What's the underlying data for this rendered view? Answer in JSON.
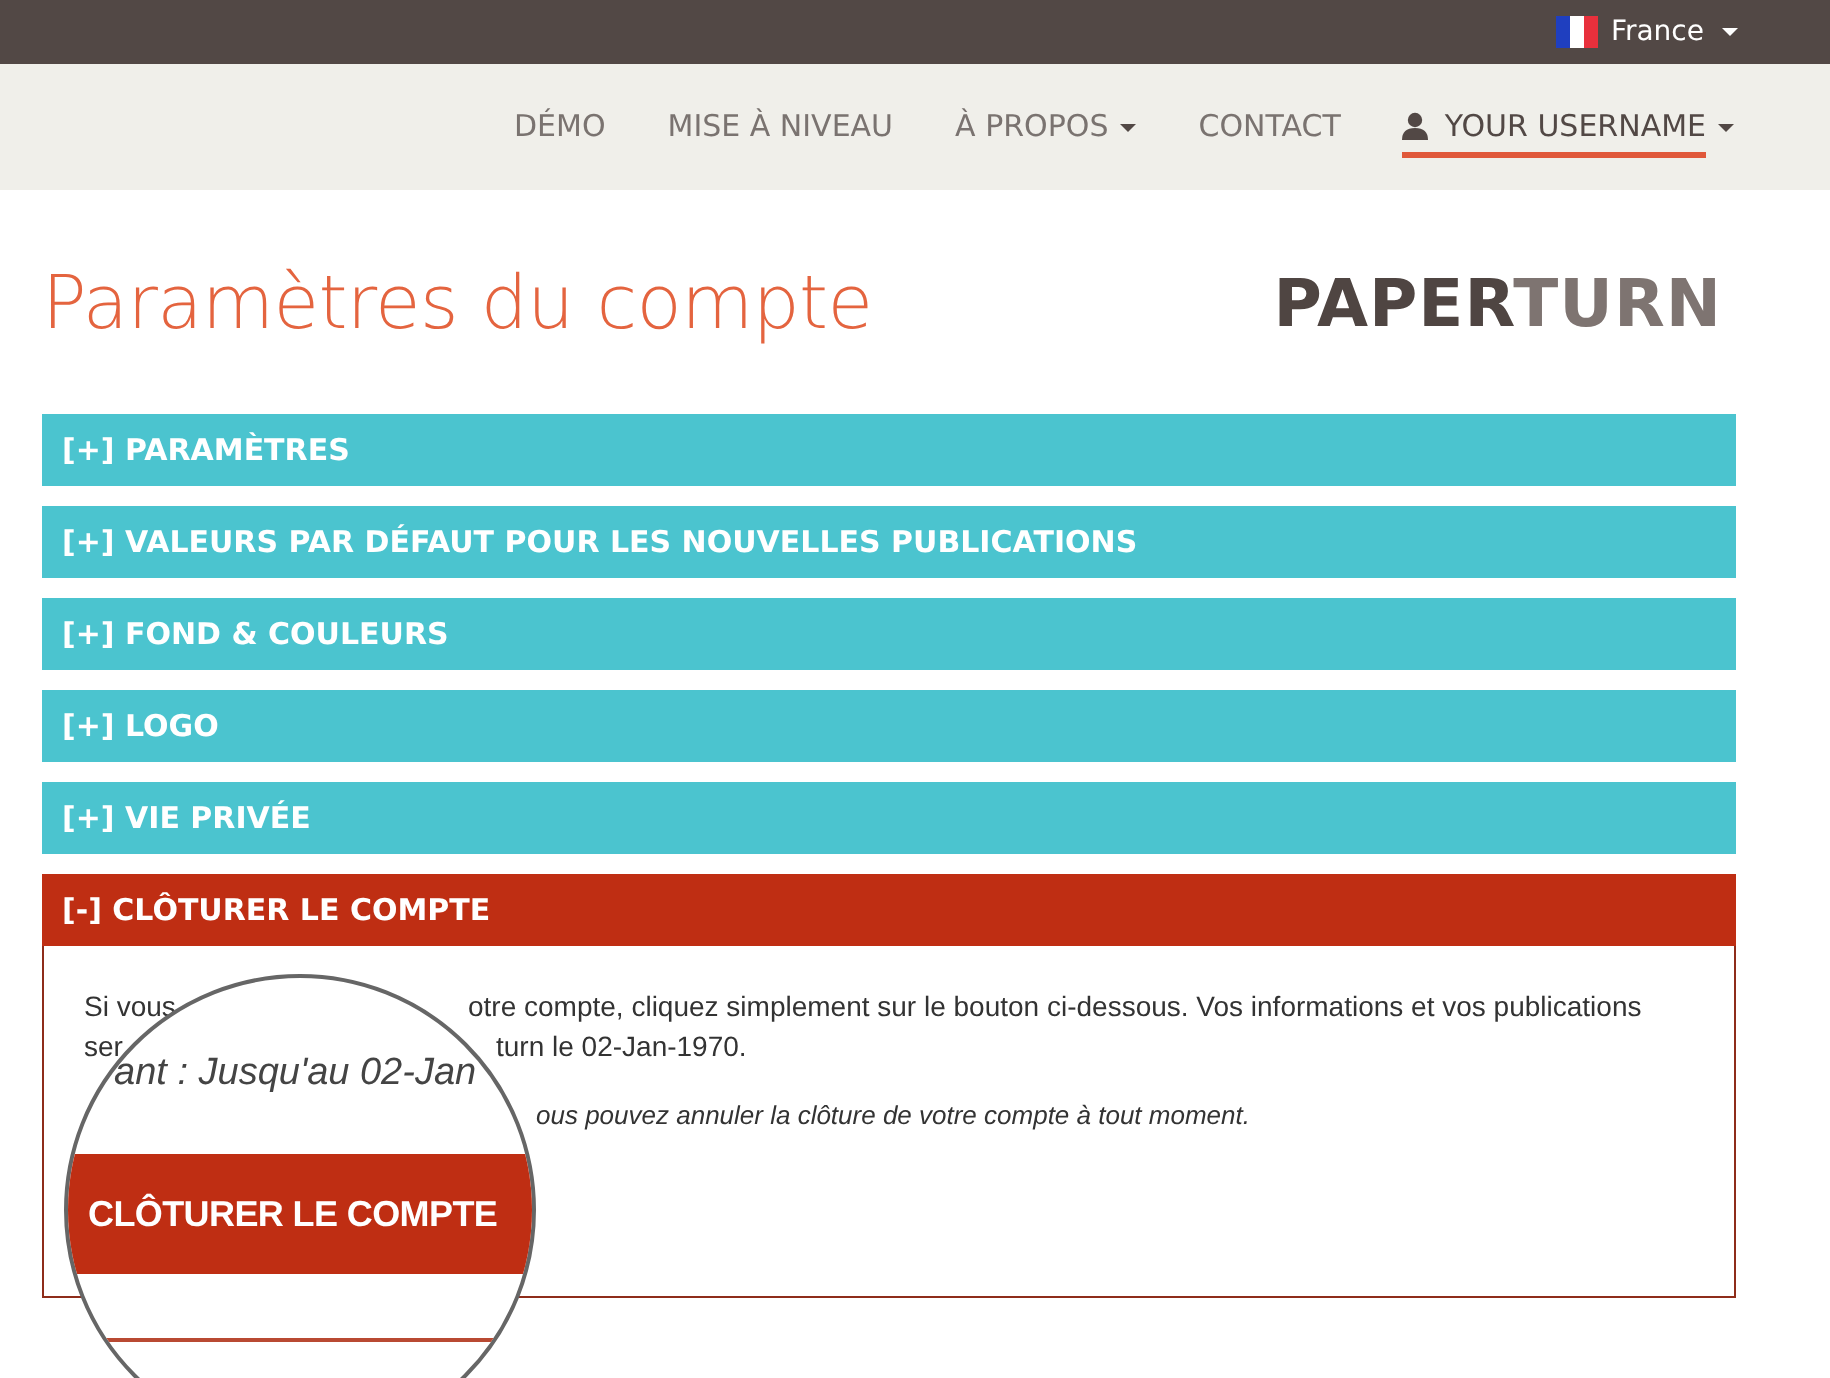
{
  "top_bar": {
    "language": "France"
  },
  "nav": {
    "items": [
      {
        "label": "DÉMO",
        "dropdown": false,
        "selected": false
      },
      {
        "label": "MISE À NIVEAU",
        "dropdown": false,
        "selected": false
      },
      {
        "label": "À PROPOS",
        "dropdown": true,
        "selected": false
      },
      {
        "label": "CONTACT",
        "dropdown": false,
        "selected": false
      }
    ],
    "user": {
      "label": "YOUR USERNAME",
      "dropdown": true,
      "selected": true
    }
  },
  "page_title": "Paramètres du compte",
  "logo": {
    "dark": "PAPER",
    "light": "TURN"
  },
  "sections": [
    {
      "label": "[+] PARAMÈTRES",
      "expanded": false
    },
    {
      "label": "[+] VALEURS PAR DÉFAUT POUR LES NOUVELLES PUBLICATIONS",
      "expanded": false
    },
    {
      "label": "[+] FOND & COULEURS",
      "expanded": false
    },
    {
      "label": "[+] LOGO",
      "expanded": false
    },
    {
      "label": "[+] VIE PRIVÉE",
      "expanded": false
    },
    {
      "label": "[-] CLÔTURER LE COMPTE",
      "expanded": true
    }
  ],
  "close_panel": {
    "lines": [
      {
        "left": "Si vous",
        "right": "otre compte, cliquez simplement sur le bouton ci-dessous. Vos informations et vos publications"
      },
      {
        "left": "ser",
        "right": "turn le 02-Jan-1970."
      }
    ],
    "note": "ous pouvez annuler la clôture de votre compte à tout moment.",
    "magnifier": {
      "text": "ant : Jusqu'au 02-Jan",
      "button": "CLÔTURER LE COMPTE"
    }
  }
}
